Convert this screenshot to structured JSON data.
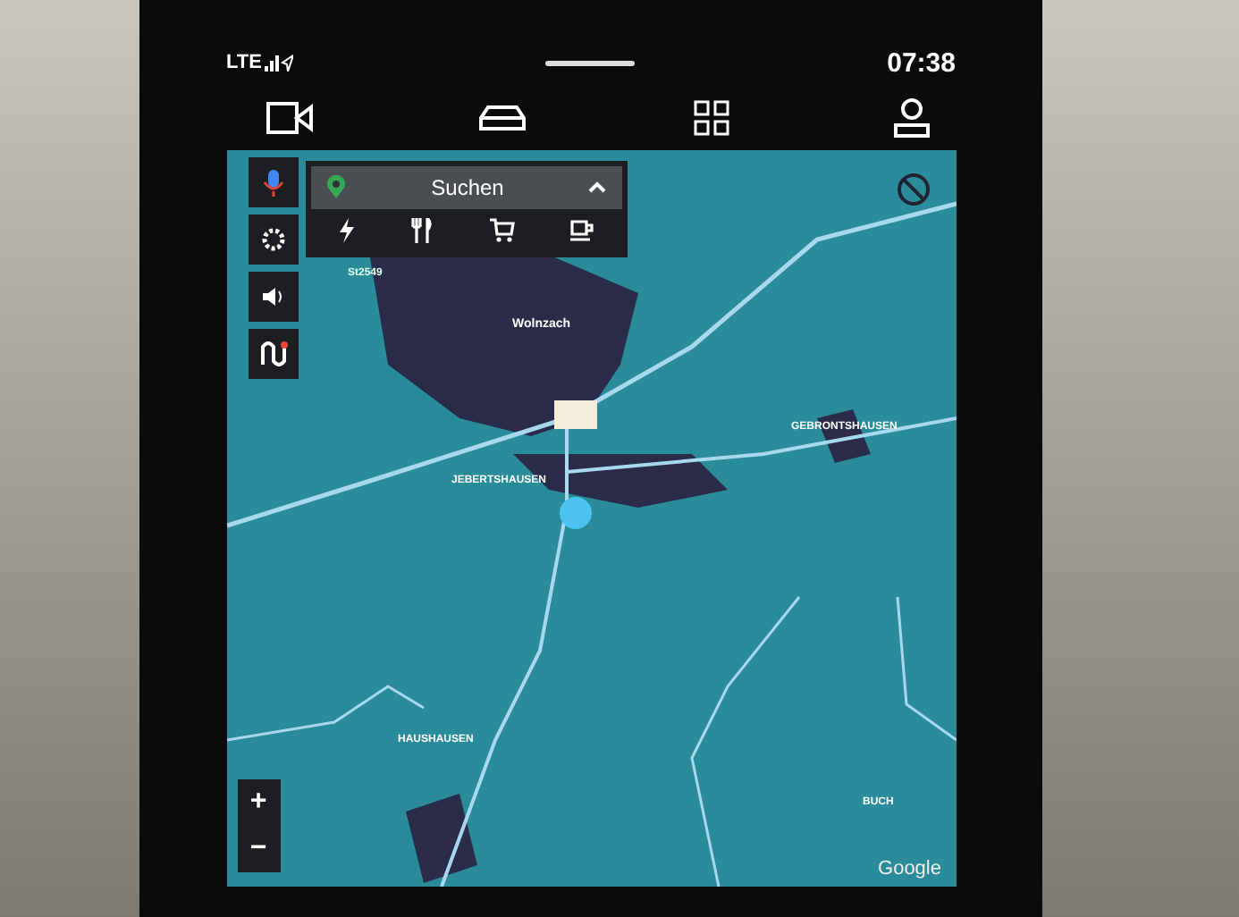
{
  "status_bar": {
    "network": "LTE",
    "time": "07:38"
  },
  "search": {
    "placeholder": "Suchen",
    "expanded": true
  },
  "map": {
    "labels": [
      {
        "text": "St2549",
        "kind": "road"
      },
      {
        "text": "Wolnzach",
        "kind": "town"
      },
      {
        "text": "JEBERTSHAUSEN",
        "kind": "village"
      },
      {
        "text": "GEBRONTSHAUSEN",
        "kind": "village"
      },
      {
        "text": "HAUSHAUSEN",
        "kind": "village"
      },
      {
        "text": "BUCH",
        "kind": "village"
      }
    ],
    "attribution": "Google"
  },
  "zoom_controls": {
    "zoom_in": "+",
    "zoom_out": "−"
  }
}
